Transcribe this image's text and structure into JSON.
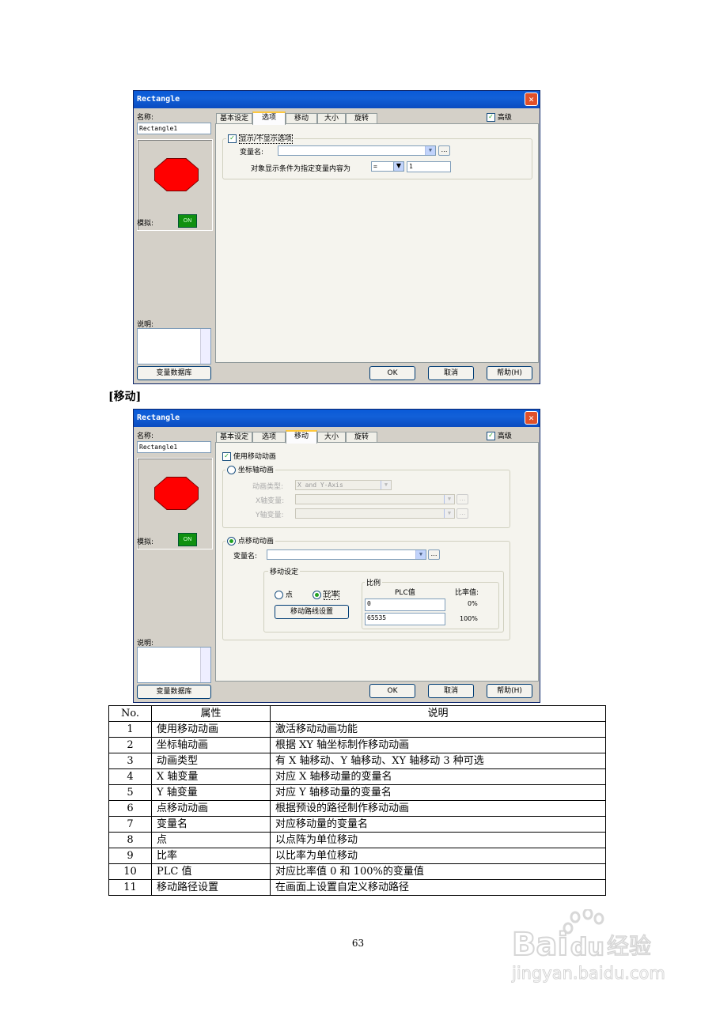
{
  "dialog_common": {
    "title": "Rectangle",
    "name_label": "名称:",
    "name_value": "Rectangle1",
    "sim_label": "模拟:",
    "sim_button": "ON",
    "desc_label": "说明:",
    "db_button": "变量数据库",
    "ok_button": "OK",
    "cancel_button": "取消",
    "help_button": "帮助(H)",
    "advanced_label": "高级",
    "tabs": [
      "基本设定",
      "选项",
      "移动",
      "大小",
      "旋转"
    ]
  },
  "dialog1": {
    "active_tab": "选项",
    "group_title": "显示/不显示选项",
    "var_label": "变量名:",
    "cond_label": "对象显示条件为指定变量内容为",
    "operator": "=",
    "value": "1"
  },
  "section_heading": "[移动]",
  "dialog2": {
    "active_tab": "移动",
    "use_motion": "使用移动动画",
    "axis_motion": "坐标轴动画",
    "anim_type_label": "动画类型:",
    "anim_type_value": "X and Y-Axis",
    "x_var_label": "X轴变量:",
    "y_var_label": "Y轴变量:",
    "point_motion": "点移动动画",
    "var_label": "变量名:",
    "move_settings": "移动设定",
    "point_option": "点",
    "ratio_option": "比率",
    "path_button": "移动路线设置",
    "ratio_group": "比例",
    "plc_header": "PLC值",
    "ratio_header": "比率值:",
    "plc_values": [
      "0",
      "65535"
    ],
    "ratio_values": [
      "0%",
      "100%"
    ]
  },
  "table": {
    "headers": [
      "No.",
      "属性",
      "说明"
    ],
    "rows": [
      [
        "1",
        "使用移动动画",
        "激活移动动画功能"
      ],
      [
        "2",
        "坐标轴动画",
        "根据 XY 轴坐标制作移动动画"
      ],
      [
        "3",
        "动画类型",
        "有 X 轴移动、Y 轴移动、XY 轴移动 3 种可选"
      ],
      [
        "4",
        "X 轴变量",
        "对应 X 轴移动量的变量名"
      ],
      [
        "5",
        "Y 轴变量",
        "对应 Y 轴移动量的变量名"
      ],
      [
        "6",
        "点移动动画",
        "根据预设的路径制作移动动画"
      ],
      [
        "7",
        "变量名",
        "对应移动量的变量名"
      ],
      [
        "8",
        "点",
        "以点阵为单位移动"
      ],
      [
        "9",
        "比率",
        "以比率为单位移动"
      ],
      [
        "10",
        "PLC 值",
        "对应比率值 0 和 100%的变量值"
      ],
      [
        "11",
        "移动路径设置",
        "在画面上设置自定义移动路径"
      ]
    ]
  },
  "page_number": "63",
  "watermark": {
    "brand": "Baidu经验",
    "url": "jingyan.baidu.com"
  }
}
